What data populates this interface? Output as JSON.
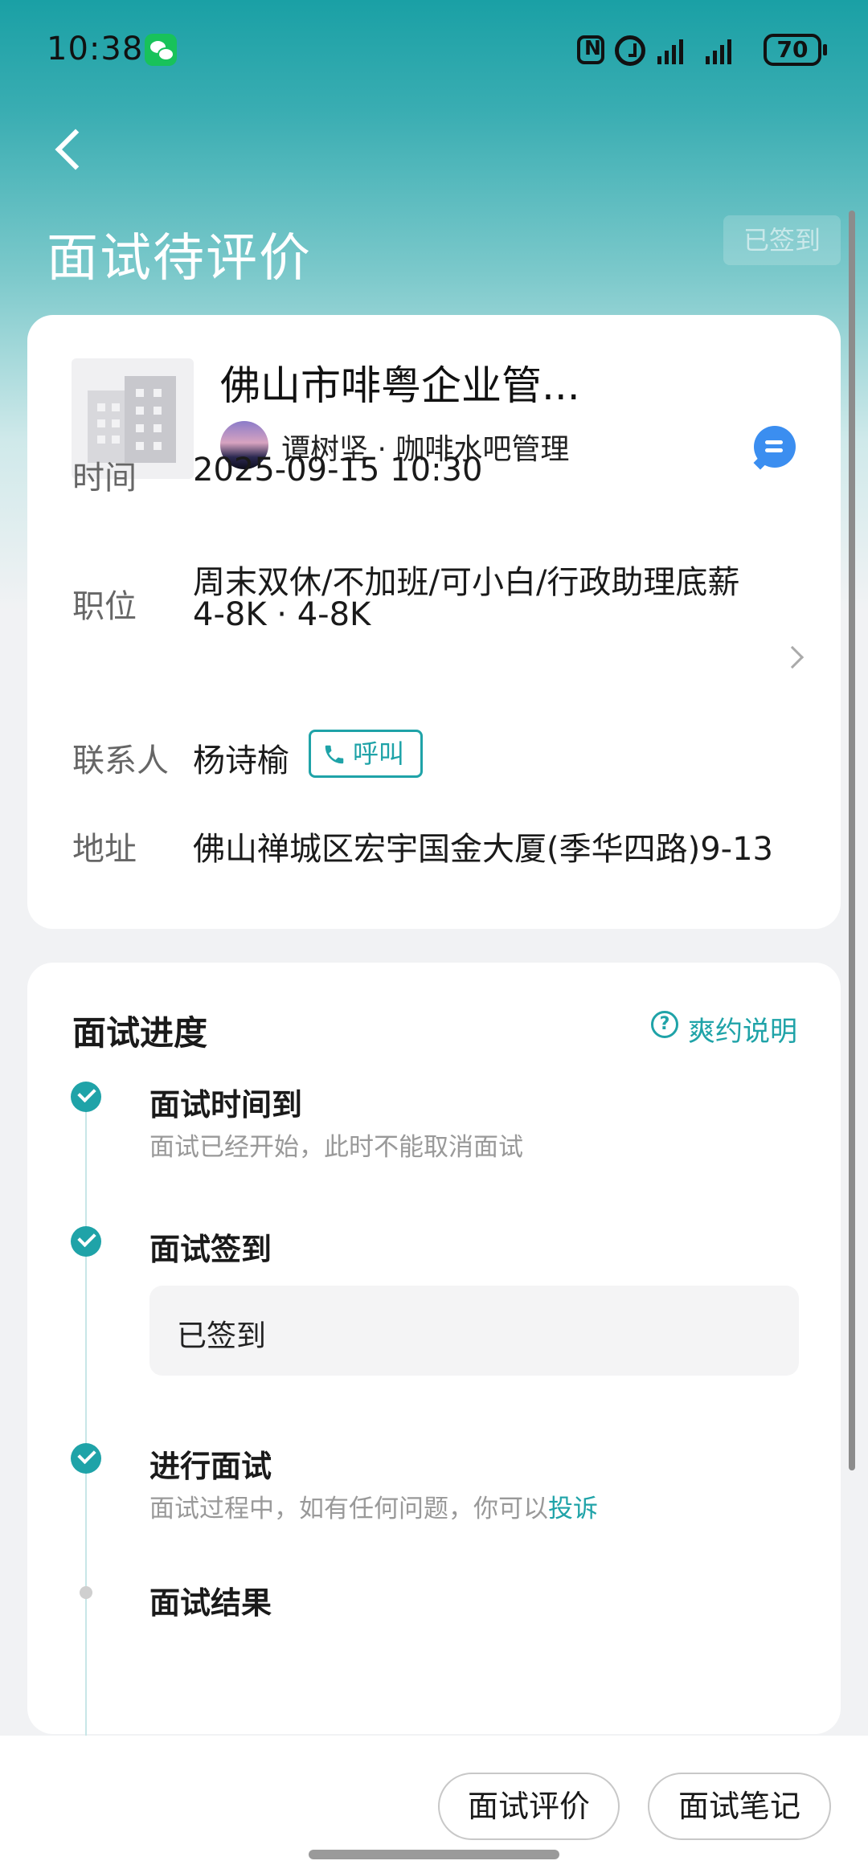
{
  "status_bar": {
    "time": "10:38",
    "battery": "70",
    "icons": [
      "wechat-icon",
      "nfc-icon",
      "alarm-icon",
      "signal-icon",
      "signal-icon",
      "battery-icon"
    ]
  },
  "header": {
    "title": "面试待评价",
    "badge": "已签到"
  },
  "job_card": {
    "company_name": "佛山市啡粤企业管...",
    "recruiter": "谭树坚 · 咖啡水吧管理",
    "time_label": "时间",
    "time_value": "2025-09-15 10:30",
    "position_label": "职位",
    "position_line1": "周末双休/不加班/可小白/行政助理底薪",
    "position_line2": "4-8K · 4-8K",
    "contact_label": "联系人",
    "contact_value": "杨诗榆",
    "call_label": "呼叫",
    "address_label": "地址",
    "address_value": "佛山禅城区宏宇国金大厦(季华四路)9-13"
  },
  "progress": {
    "title": "面试进度",
    "help_label": "爽约说明",
    "help_icon_glyph": "?",
    "steps": [
      {
        "title": "面试时间到",
        "desc": "面试已经开始，此时不能取消面试",
        "status": "done"
      },
      {
        "title": "面试签到",
        "box_text": "已签到",
        "status": "done"
      },
      {
        "title": "进行面试",
        "desc": "面试过程中，如有任何问题，你可以",
        "link": "投诉",
        "status": "done"
      },
      {
        "title": "面试结果",
        "status": "pending"
      }
    ]
  },
  "bottom_bar": {
    "evaluate_label": "面试评价",
    "notes_label": "面试笔记"
  },
  "colors": {
    "accent": "#1fa3a8",
    "chat_blue": "#3b8ef0"
  }
}
